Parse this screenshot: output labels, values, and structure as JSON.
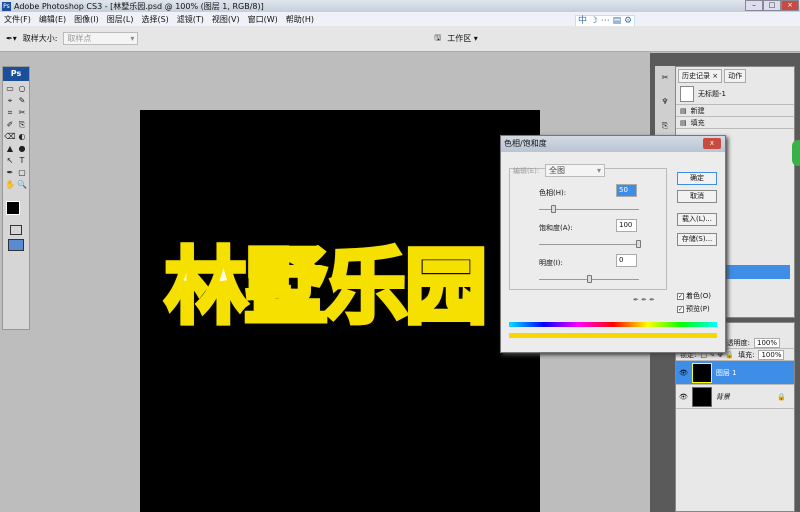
{
  "titlebar": {
    "title": "Adobe Photoshop CS3 - [林墅乐园.psd @ 100% (图层 1, RGB/8)]",
    "app_icon": "Ps"
  },
  "menubar": {
    "items": [
      "文件(F)",
      "编辑(E)",
      "图像(I)",
      "图层(L)",
      "选择(S)",
      "滤镜(T)",
      "视图(V)",
      "窗口(W)",
      "帮助(H)"
    ]
  },
  "ime": {
    "text": "中"
  },
  "options": {
    "sample_size_label": "取样大小:",
    "sample_size_value": "取样点",
    "workspace_label": "工作区 ▾"
  },
  "toolbox": {
    "logo": "Ps",
    "tools": [
      "▭",
      "○",
      "⌖",
      "✎",
      "⌗",
      "✂",
      "✐",
      "⎘",
      "⌫",
      "◐",
      "▲",
      "●",
      "↖",
      "T",
      "✒",
      "▢",
      "✋",
      "🔍"
    ]
  },
  "canvas": {
    "art_text": "林墅乐园"
  },
  "history": {
    "tabs": [
      "历史记录 ×",
      "动作"
    ],
    "snapshot": "无标题-1",
    "items": [
      "新建",
      "填充"
    ]
  },
  "layers": {
    "opacity_label": "不透明度:",
    "opacity": "100%",
    "lock_label": "锁定:",
    "fill_label": "填充:",
    "fill": "100%",
    "items": [
      {
        "name": "图层 1",
        "selected": true
      },
      {
        "name": "背景",
        "locked": true
      }
    ]
  },
  "dialog": {
    "title": "色相/饱和度",
    "edit_label": "编辑(E):",
    "edit_value": "全图",
    "hue_label": "色相(H):",
    "hue": "50",
    "saturation_label": "饱和度(A):",
    "saturation": "100",
    "lightness_label": "明度(I):",
    "lightness": "0",
    "ok": "确定",
    "cancel": "取消",
    "load": "载入(L)...",
    "save": "存储(S)...",
    "colorize": "着色(O)",
    "preview": "预览(P)",
    "colors": {
      "accent": "#3e8ee8",
      "art_yellow": "#f5e000"
    }
  }
}
